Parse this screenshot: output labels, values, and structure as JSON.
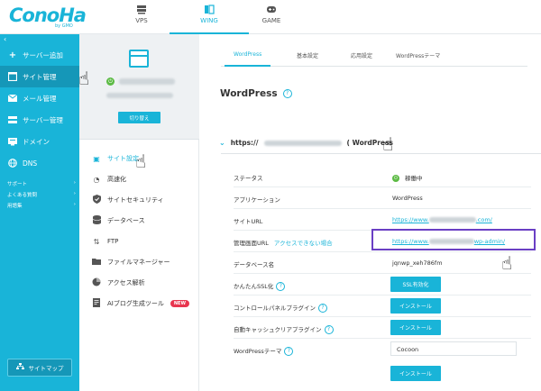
{
  "header": {
    "logo": "ConoHa",
    "logo_sub": "by GMO",
    "services": [
      {
        "label": "VPS",
        "active": false
      },
      {
        "label": "WING",
        "active": true
      },
      {
        "label": "GAME",
        "active": false
      }
    ]
  },
  "sidebar": {
    "collapse_icon": "chevron-left-icon",
    "items": [
      {
        "label": "サーバー追加",
        "icon": "plus-icon"
      },
      {
        "label": "サイト管理",
        "icon": "window-icon",
        "active": true
      },
      {
        "label": "メール管理",
        "icon": "mail-icon"
      },
      {
        "label": "サーバー管理",
        "icon": "server-icon"
      },
      {
        "label": "ドメイン",
        "icon": "domain-icon"
      },
      {
        "label": "DNS",
        "icon": "globe-icon"
      }
    ],
    "small_links": [
      {
        "label": "サポート"
      },
      {
        "label": "よくある質問"
      },
      {
        "label": "用語集"
      }
    ],
    "sitemap_label": "サイトマップ",
    "accent_color": "#19b4d8"
  },
  "site_panel": {
    "switch_label": "切り替え",
    "menu": [
      {
        "label": "サイト設定",
        "icon": "settings-page-icon",
        "active": true
      },
      {
        "label": "高速化",
        "icon": "speedometer-icon"
      },
      {
        "label": "サイトセキュリティ",
        "icon": "shield-icon"
      },
      {
        "label": "データベース",
        "icon": "database-icon"
      },
      {
        "label": "FTP",
        "icon": "updown-arrows-icon"
      },
      {
        "label": "ファイルマネージャー",
        "icon": "folder-icon"
      },
      {
        "label": "アクセス解析",
        "icon": "pie-chart-icon"
      },
      {
        "label": "AIブログ生成ツール",
        "icon": "document-icon",
        "badge": "NEW"
      }
    ]
  },
  "main": {
    "tabs": [
      {
        "label": "WordPress",
        "active": true
      },
      {
        "label": "基本設定"
      },
      {
        "label": "応用設定"
      },
      {
        "label": "WordPressテーマ"
      }
    ],
    "title": "WordPress",
    "section_prefix": "https://",
    "section_suffix": "( WordPress",
    "rows": {
      "status_label": "ステータス",
      "status_value": "稼働中",
      "app_label": "アプリケーション",
      "app_value": "WordPress",
      "site_url_label": "サイトURL",
      "site_url_start": "https://www.",
      "site_url_end": ".com/",
      "admin_url_label": "管理画面URL",
      "admin_url_sub": "アクセスできない場合",
      "admin_url_start": "https://www.",
      "admin_url_end": "wp-admin/",
      "db_label": "データベース名",
      "db_value": "jqnwp_xeh786fm",
      "ssl_label": "かんたんSSL化",
      "ssl_button": "SSL有効化",
      "cp_label": "コントロールパネルプラグイン",
      "cp_button": "インストール",
      "cache_label": "自動キャッシュクリアプラグイン",
      "cache_button": "インストール",
      "theme_label": "WordPressテーマ",
      "theme_value": "Cocoon",
      "theme_button": "インストール"
    },
    "highlight_color": "#6a3fc4"
  }
}
